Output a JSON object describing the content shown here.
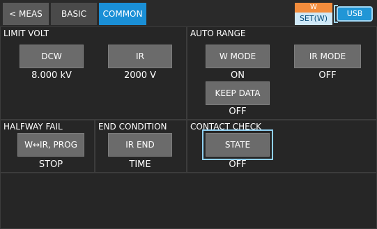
{
  "tabs": {
    "meas": "< MEAS",
    "basic": "BASIC",
    "common": "COMMON"
  },
  "status": {
    "mode_top": "W",
    "mode_bottom": "SET(W)",
    "usb": "USB"
  },
  "limit_volt": {
    "title": "LIMIT VOLT",
    "dcw_label": "DCW",
    "dcw_value": "8.000 kV",
    "ir_label": "IR",
    "ir_value": "2000 V"
  },
  "auto_range": {
    "title": "AUTO RANGE",
    "w_mode_label": "W MODE",
    "w_mode_value": "ON",
    "ir_mode_label": "IR MODE",
    "ir_mode_value": "OFF",
    "keep_data_label": "KEEP DATA",
    "keep_data_value": "OFF"
  },
  "halfway_fail": {
    "title": "HALFWAY FAIL",
    "button_label": "W↔IR, PROG",
    "value": "STOP"
  },
  "end_condition": {
    "title": "END CONDITION",
    "button_label": "IR END",
    "value": "TIME"
  },
  "contact_check": {
    "title": "CONTACT CHECK",
    "button_label": "STATE",
    "value": "OFF"
  },
  "colors": {
    "accent": "#1a8fd6",
    "mode_top": "#f28c3c",
    "mode_bottom": "#cfe8f7"
  }
}
